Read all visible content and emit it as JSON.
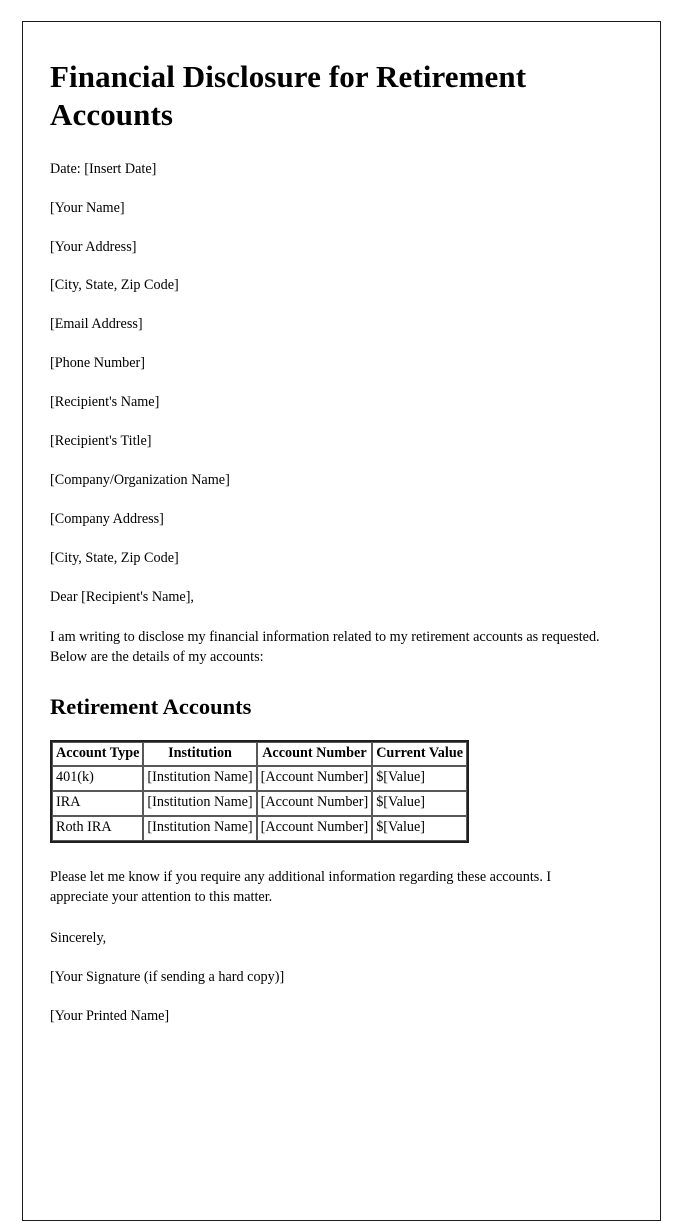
{
  "document": {
    "title": "Financial Disclosure for Retirement Accounts",
    "date_line": "Date: [Insert Date]",
    "sender_block": [
      "[Your Name]",
      "[Your Address]",
      "[City, State, Zip Code]",
      "[Email Address]",
      "[Phone Number]"
    ],
    "recipient_block": [
      "[Recipient's Name]",
      "[Recipient's Title]",
      "[Company/Organization Name]",
      "[Company Address]",
      "[City, State, Zip Code]"
    ],
    "salutation": "Dear [Recipient's Name],",
    "intro_paragraph": "I am writing to disclose my financial information related to my retirement accounts as requested. Below are the details of my accounts:",
    "section_heading": "Retirement Accounts",
    "table": {
      "headers": [
        "Account Type",
        "Institution",
        "Account Number",
        "Current Value"
      ],
      "rows": [
        [
          "401(k)",
          "[Institution Name]",
          "[Account Number]",
          "$[Value]"
        ],
        [
          "IRA",
          "[Institution Name]",
          "[Account Number]",
          "$[Value]"
        ],
        [
          "Roth IRA",
          "[Institution Name]",
          "[Account Number]",
          "$[Value]"
        ]
      ]
    },
    "closing_paragraph": "Please let me know if you require any additional information regarding these accounts. I appreciate your attention to this matter.",
    "sign_off": "Sincerely,",
    "signature_line": "[Your Signature (if sending a hard copy)]",
    "printed_name_line": "[Your Printed Name]"
  },
  "colors": {
    "text": "#000000",
    "page_border": "#1c1c1c",
    "table_border": "#1f1f1f",
    "cell_border": "#585858",
    "background": "#ffffff"
  }
}
